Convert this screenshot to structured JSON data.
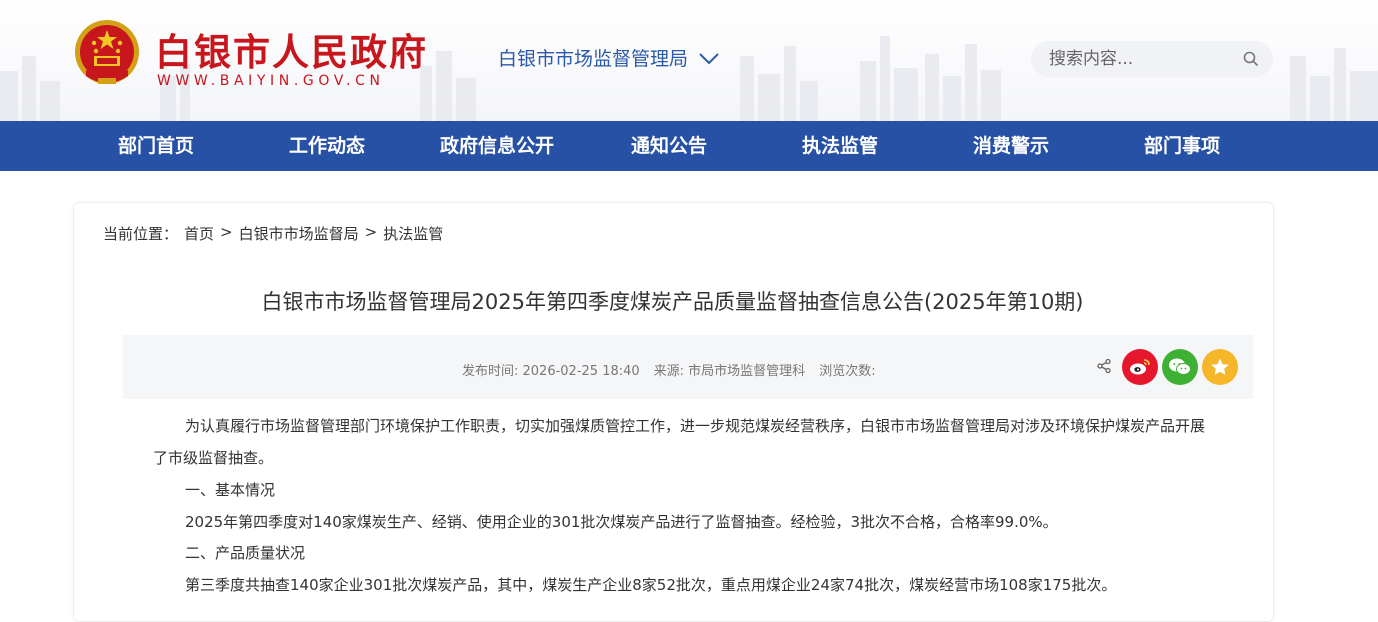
{
  "site": {
    "title": "白银市人民政府",
    "url": "WWW.BAIYIN.GOV.CN",
    "department": "白银市市场监督管理局"
  },
  "search": {
    "placeholder": "搜索内容..."
  },
  "nav": {
    "items": [
      "部门首页",
      "工作动态",
      "政府信息公开",
      "通知公告",
      "执法监管",
      "消费警示",
      "部门事项"
    ]
  },
  "breadcrumb": {
    "prefix": "当前位置：",
    "items": [
      "首页",
      "白银市市场监督局",
      "执法监管"
    ],
    "separator": ">"
  },
  "article": {
    "title": "白银市市场监督管理局2025年第四季度煤炭产品质量监督抽查信息公告(2025年第10期)",
    "meta": {
      "publish_time": "发布时间: 2026-02-25 18:40",
      "source": "来源: 市局市场监督管理科",
      "views": "浏览次数:"
    },
    "paragraphs": [
      "为认真履行市场监督管理部门环境保护工作职责，切实加强煤质管控工作，进一步规范煤炭经营秩序，白银市市场监督管理局对涉及环境保护煤炭产品开展了市级监督抽查。",
      "一、基本情况",
      "2025年第四季度对140家煤炭生产、经销、使用企业的301批次煤炭产品进行了监督抽查。经检验，3批次不合格，合格率99.0%。",
      "二、产品质量状况",
      "第三季度共抽查140家企业301批次煤炭产品，其中，煤炭生产企业8家52批次，重点用煤企业24家74批次，煤炭经营市场108家175批次。"
    ]
  },
  "colors": {
    "brand_red": "#c8161d",
    "nav_blue": "#2751a5",
    "dept_blue": "#2c5aa8",
    "weibo": "#e6162d",
    "wechat": "#3eb135",
    "favorite": "#f5b62a"
  },
  "icons": [
    "national-emblem-icon",
    "chevron-down-icon",
    "search-icon",
    "share-icon",
    "weibo-icon",
    "wechat-icon",
    "star-icon"
  ]
}
